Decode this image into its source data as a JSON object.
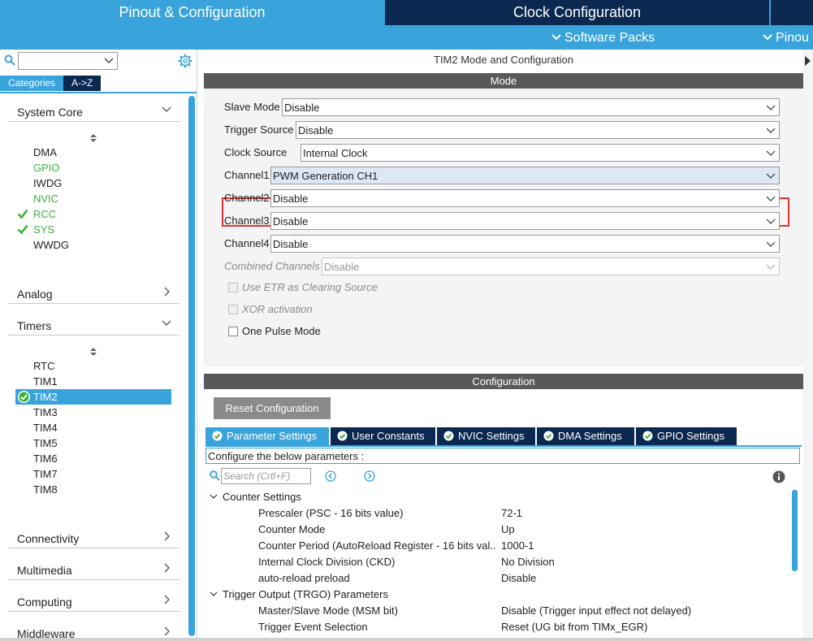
{
  "top_tabs": {
    "pinout": "Pinout & Configuration",
    "clock": "Clock Configuration",
    "software_packs": "Software Packs",
    "pinout_view": "Pinou"
  },
  "left": {
    "search_value": "",
    "category_tabs": [
      "Categories",
      "A->Z"
    ],
    "groups": {
      "system_core": "System Core",
      "analog": "Analog",
      "timers": "Timers",
      "connectivity": "Connectivity",
      "multimedia": "Multimedia",
      "computing": "Computing",
      "middleware": "Middleware"
    },
    "system_core_items": [
      {
        "label": "DMA",
        "status": "normal"
      },
      {
        "label": "GPIO",
        "status": "green"
      },
      {
        "label": "IWDG",
        "status": "normal"
      },
      {
        "label": "NVIC",
        "status": "green"
      },
      {
        "label": "RCC",
        "status": "checked"
      },
      {
        "label": "SYS",
        "status": "checked"
      },
      {
        "label": "WWDG",
        "status": "normal"
      }
    ],
    "timer_items": [
      {
        "label": "RTC",
        "status": "normal"
      },
      {
        "label": "TIM1",
        "status": "normal"
      },
      {
        "label": "TIM2",
        "status": "selected"
      },
      {
        "label": "TIM3",
        "status": "normal"
      },
      {
        "label": "TIM4",
        "status": "normal"
      },
      {
        "label": "TIM5",
        "status": "normal"
      },
      {
        "label": "TIM6",
        "status": "normal"
      },
      {
        "label": "TIM7",
        "status": "normal"
      },
      {
        "label": "TIM8",
        "status": "normal"
      }
    ]
  },
  "right": {
    "title": "TIM2 Mode and Configuration",
    "mode_header": "Mode",
    "mode_fields": [
      {
        "label": "Slave Mode",
        "value": "Disable"
      },
      {
        "label": "Trigger Source",
        "value": "Disable"
      },
      {
        "label": "Clock Source",
        "value": "Internal Clock"
      },
      {
        "label": "Channel1",
        "value": "PWM Generation CH1"
      },
      {
        "label": "Channel2",
        "value": "Disable"
      },
      {
        "label": "Channel3",
        "value": "Disable"
      },
      {
        "label": "Channel4",
        "value": "Disable"
      },
      {
        "label": "Combined Channels",
        "value": "Disable"
      }
    ],
    "checkboxes": [
      {
        "label": "Use ETR as Clearing Source",
        "enabled": false,
        "checked": false
      },
      {
        "label": "XOR activation",
        "enabled": false,
        "checked": false
      },
      {
        "label": "One Pulse Mode",
        "enabled": true,
        "checked": false
      }
    ],
    "config_header": "Configuration",
    "reset_button": "Reset Configuration",
    "config_tabs": [
      "Parameter Settings",
      "User Constants",
      "NVIC Settings",
      "DMA Settings",
      "GPIO Settings"
    ],
    "configure_text": "Configure the below parameters :",
    "search_placeholder": "Search (Crtl+F)",
    "param_groups": {
      "counter": "Counter Settings",
      "trgo": "Trigger Output (TRGO) Parameters"
    },
    "params": [
      {
        "name": "Prescaler (PSC - 16 bits value)",
        "value": "72-1"
      },
      {
        "name": "Counter Mode",
        "value": "Up"
      },
      {
        "name": "Counter Period (AutoReload Register - 16 bits val...",
        "value": "1000-1"
      },
      {
        "name": "Internal Clock Division (CKD)",
        "value": "No Division"
      },
      {
        "name": "auto-reload preload",
        "value": "Disable"
      },
      {
        "name": "Master/Slave Mode (MSM bit)",
        "value": "Disable (Trigger input effect not delayed)"
      },
      {
        "name": "Trigger Event Selection",
        "value": "Reset (UG bit from TIMx_EGR)"
      }
    ]
  },
  "colors": {
    "accent_blue": "#39a3db",
    "dark_navy": "#0a2850",
    "section_gray": "#595959",
    "status_green": "#3caf3c",
    "highlight_red": "#e03232"
  }
}
